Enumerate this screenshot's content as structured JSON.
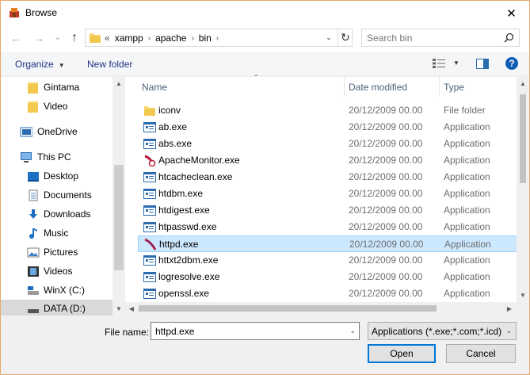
{
  "window": {
    "title": "Browse",
    "close_glyph": "✕"
  },
  "nav": {
    "back_glyph": "←",
    "forward_glyph": "→",
    "recent_glyph": "⌄",
    "up_glyph": "↑"
  },
  "address": {
    "overflow": "«",
    "crumbs": [
      "xampp",
      "apache",
      "bin"
    ],
    "separator": "›",
    "dropdown_glyph": "⌄",
    "refresh_glyph": "↻"
  },
  "search": {
    "placeholder": "Search bin"
  },
  "toolbar": {
    "organize_label": "Organize",
    "new_folder_label": "New folder",
    "help_glyph": "?"
  },
  "sidebar": {
    "items": [
      {
        "label": "Gintama",
        "icon": "folder-icon"
      },
      {
        "label": "Video",
        "icon": "folder-icon"
      },
      {
        "label": "OneDrive",
        "icon": "onedrive-icon"
      },
      {
        "label": "This PC",
        "icon": "this-pc-icon"
      },
      {
        "label": "Desktop",
        "icon": "desktop-icon"
      },
      {
        "label": "Documents",
        "icon": "documents-icon"
      },
      {
        "label": "Downloads",
        "icon": "downloads-icon"
      },
      {
        "label": "Music",
        "icon": "music-icon"
      },
      {
        "label": "Pictures",
        "icon": "pictures-icon"
      },
      {
        "label": "Videos",
        "icon": "videos-icon"
      },
      {
        "label": "WinX (C:)",
        "icon": "drive-icon"
      },
      {
        "label": "DATA (D:)",
        "icon": "drive-icon"
      }
    ]
  },
  "columns": {
    "name": "Name",
    "date": "Date modified",
    "type": "Type"
  },
  "files": [
    {
      "name": "iconv",
      "date": "20/12/2009 00.00",
      "type": "File folder",
      "icon": "folder-icon"
    },
    {
      "name": "ab.exe",
      "date": "20/12/2009 00.00",
      "type": "Application",
      "icon": "app-icon"
    },
    {
      "name": "abs.exe",
      "date": "20/12/2009 00.00",
      "type": "Application",
      "icon": "app-icon"
    },
    {
      "name": "ApacheMonitor.exe",
      "date": "20/12/2009 00.00",
      "type": "Application",
      "icon": "apache-monitor-icon"
    },
    {
      "name": "htcacheclean.exe",
      "date": "20/12/2009 00.00",
      "type": "Application",
      "icon": "app-icon"
    },
    {
      "name": "htdbm.exe",
      "date": "20/12/2009 00.00",
      "type": "Application",
      "icon": "app-icon"
    },
    {
      "name": "htdigest.exe",
      "date": "20/12/2009 00.00",
      "type": "Application",
      "icon": "app-icon"
    },
    {
      "name": "htpasswd.exe",
      "date": "20/12/2009 00.00",
      "type": "Application",
      "icon": "app-icon"
    },
    {
      "name": "httpd.exe",
      "date": "20/12/2009 00.00",
      "type": "Application",
      "icon": "apache-feather-icon"
    },
    {
      "name": "httxt2dbm.exe",
      "date": "20/12/2009 00.00",
      "type": "Application",
      "icon": "app-icon"
    },
    {
      "name": "logresolve.exe",
      "date": "20/12/2009 00.00",
      "type": "Application",
      "icon": "app-icon"
    },
    {
      "name": "openssl.exe",
      "date": "20/12/2009 00.00",
      "type": "Application",
      "icon": "app-icon"
    }
  ],
  "footer": {
    "file_name_label": "File name:",
    "file_name_value": "httpd.exe",
    "filter_value": "Applications (*.exe;*.com;*.icd)",
    "open_label": "Open",
    "cancel_label": "Cancel",
    "dropdown_glyph": "⌄"
  },
  "colors": {
    "accent": "#0078d7",
    "selection_bg": "#cce8ff",
    "selection_border": "#99d1ff",
    "link_text": "#1e3287",
    "folder": "#f8d775"
  }
}
